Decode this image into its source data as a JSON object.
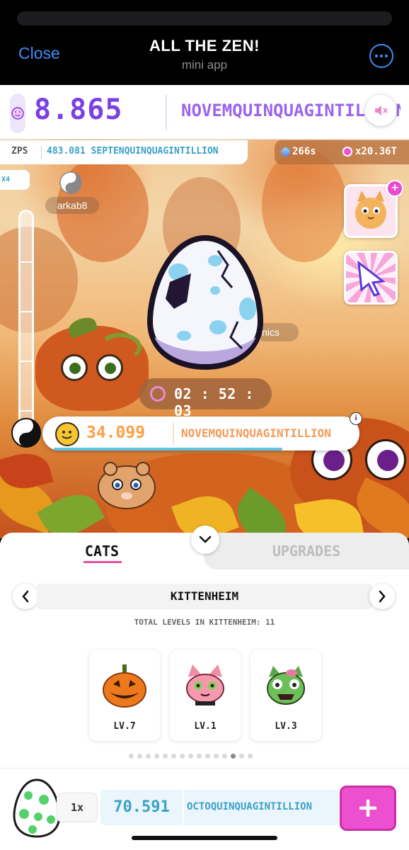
{
  "header": {
    "close_label": "Close",
    "title": "ALL THE ZEN!",
    "subtitle": "mini app"
  },
  "game": {
    "score_value": "8.865",
    "score_unit": "NOVEMQUINQUAGINTILLION",
    "zps_label": "ZPS",
    "zps_value": "483.081 SEPTENQUINQUAGINTILLION",
    "gems_value": "266s",
    "multiplier_value": "x20.36T",
    "boost_badge": "X4",
    "player_name": "arkab8",
    "player_name_2": "nics",
    "timer": "02 : 52 : 03",
    "zen_value": "34.099",
    "zen_unit": "NOVEMQUINQUAGINTILLION",
    "zen_progress_fraction": 0.72,
    "info_icon": "i"
  },
  "tabs": [
    {
      "label": "CATS",
      "active": true
    },
    {
      "label": "UPGRADES",
      "active": false
    }
  ],
  "region": {
    "name": "KITTENHEIM",
    "total_levels": "TOTAL LEVELS IN KITTENHEIM: 11"
  },
  "cards": [
    {
      "name": "jack-o-lantern",
      "level": "LV.7"
    },
    {
      "name": "pink-cat",
      "level": "LV.1"
    },
    {
      "name": "zombie-cat",
      "level": "LV.3"
    }
  ],
  "pagination": {
    "total": 15,
    "active_index": 12
  },
  "purchase": {
    "quantity": "1x",
    "price_value": "70.591",
    "price_unit": "OCTOQUINQUAGINTILLION",
    "buy_label": "+"
  },
  "colors": {
    "accent_purple": "#7b3fe4",
    "accent_pink": "#ec4fcf",
    "accent_blue": "#3aa0c8",
    "zen_orange": "#ff9f43",
    "ios_blue": "#3d8ef7"
  },
  "icons": [
    "more-icon",
    "mute-icon",
    "yin-yang-icon",
    "chevron-down-icon",
    "chevron-left-icon",
    "chevron-right-icon",
    "plus-icon",
    "info-icon"
  ]
}
